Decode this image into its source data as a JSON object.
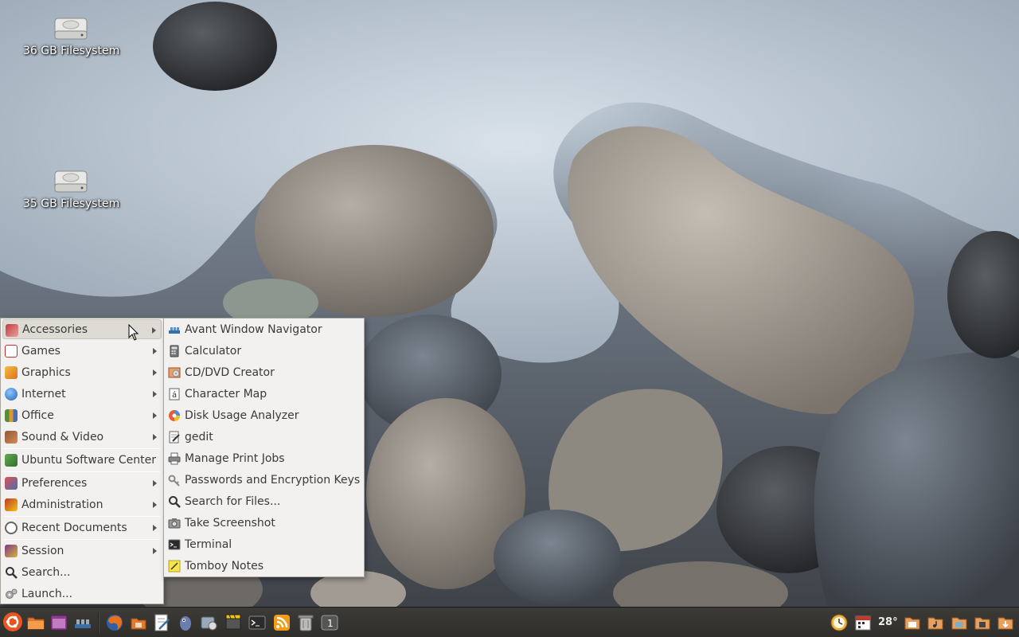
{
  "desktop": {
    "icons": [
      {
        "label": "36 GB Filesystem",
        "icon": "drive-harddisk-icon"
      },
      {
        "label": "35 GB Filesystem",
        "icon": "drive-harddisk-icon"
      }
    ]
  },
  "main_menu": {
    "items": [
      {
        "label": "Accessories",
        "icon": "accessories-icon",
        "submenu": true,
        "active": true
      },
      {
        "label": "Games",
        "icon": "games-icon",
        "submenu": true
      },
      {
        "label": "Graphics",
        "icon": "graphics-icon",
        "submenu": true
      },
      {
        "label": "Internet",
        "icon": "internet-globe-icon",
        "submenu": true
      },
      {
        "label": "Office",
        "icon": "office-icon",
        "submenu": true
      },
      {
        "label": "Sound & Video",
        "icon": "sound-video-icon",
        "submenu": true
      },
      {
        "label": "Ubuntu Software Center",
        "icon": "software-center-icon",
        "submenu": false
      },
      {
        "label": "Preferences",
        "icon": "preferences-icon",
        "submenu": true
      },
      {
        "label": "Administration",
        "icon": "administration-icon",
        "submenu": true
      },
      {
        "label": "Recent Documents",
        "icon": "recent-documents-icon",
        "submenu": true
      },
      {
        "label": "Session",
        "icon": "session-icon",
        "submenu": true
      },
      {
        "label": "Search...",
        "icon": "search-icon",
        "submenu": false
      },
      {
        "label": "Launch...",
        "icon": "launch-gears-icon",
        "submenu": false
      }
    ]
  },
  "accessories_menu": {
    "items": [
      {
        "label": "Avant Window Navigator",
        "icon": "avant-window-navigator-icon"
      },
      {
        "label": "Calculator",
        "icon": "calculator-icon"
      },
      {
        "label": "CD/DVD Creator",
        "icon": "cd-dvd-creator-icon"
      },
      {
        "label": "Character Map",
        "icon": "character-map-icon"
      },
      {
        "label": "Disk Usage Analyzer",
        "icon": "disk-usage-analyzer-icon"
      },
      {
        "label": "gedit",
        "icon": "gedit-icon"
      },
      {
        "label": "Manage Print Jobs",
        "icon": "printer-icon"
      },
      {
        "label": "Passwords and Encryption Keys",
        "icon": "keys-icon"
      },
      {
        "label": "Search for Files...",
        "icon": "search-icon"
      },
      {
        "label": "Take Screenshot",
        "icon": "screenshot-camera-icon"
      },
      {
        "label": "Terminal",
        "icon": "terminal-icon"
      },
      {
        "label": "Tomboy Notes",
        "icon": "tomboy-notes-icon"
      }
    ]
  },
  "panel": {
    "weather_temp": "28°",
    "launchers": [
      "ubuntu-menu-icon",
      "home-folder-icon",
      "desktop-icon",
      "avant-navigator-icon",
      "firefox-icon",
      "file-manager-icon",
      "text-editor-icon",
      "pidgin-icon",
      "system-monitor-icon",
      "video-icon",
      "terminal-icon",
      "rss-feed-icon",
      "trash-icon",
      "workspace-switcher-icon"
    ],
    "tray": [
      "clock-icon",
      "calendar-icon",
      "weather-icon",
      "documents-folder-icon",
      "music-folder-icon",
      "pictures-folder-icon",
      "videos-folder-icon",
      "downloads-folder-icon"
    ]
  },
  "colors": {
    "menu_bg": "#f2f1ef",
    "menu_active": "#dedbd4",
    "panel_bg": "#3c3b37",
    "ubuntu_orange": "#e95420"
  }
}
